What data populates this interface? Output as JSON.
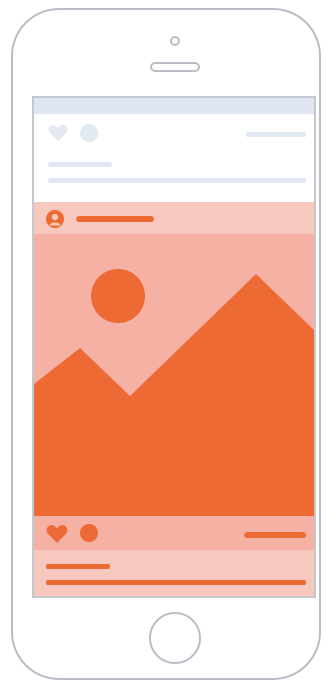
{
  "colors": {
    "accent": "#ee6a34",
    "card_background": "#f7c8bd",
    "image_background": "#f5b2a4",
    "placeholder_gray": "#e3e9f2",
    "status_bar": "#dfe6f1",
    "device_outline": "#b9bec6"
  },
  "icons": {
    "previous_like": "heart-icon",
    "previous_comment": "comment-bubble-icon",
    "avatar": "user-avatar-icon",
    "image_placeholder": "landscape-image-icon",
    "like": "heart-icon",
    "comment": "comment-bubble-icon"
  }
}
